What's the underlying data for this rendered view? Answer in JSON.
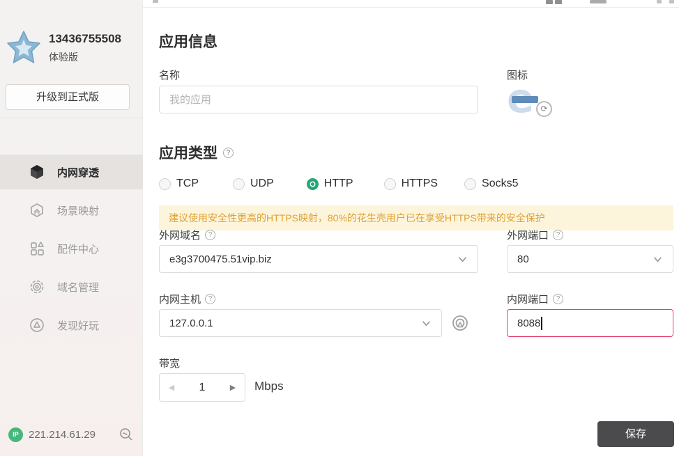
{
  "sidebar": {
    "account": {
      "phone": "13436755508",
      "plan": "体验版"
    },
    "upgrade_button": "升级到正式版",
    "menu": [
      {
        "label": "内网穿透",
        "icon": "cube-icon",
        "active": true
      },
      {
        "label": "场景映射",
        "icon": "scene-mapping-icon",
        "active": false
      },
      {
        "label": "配件中心",
        "icon": "addons-grid-icon",
        "active": false
      },
      {
        "label": "域名管理",
        "icon": "domain-gear-icon",
        "active": false
      },
      {
        "label": "发现好玩",
        "icon": "discover-compass-icon",
        "active": false
      }
    ],
    "footer": {
      "ip": "221.214.61.29"
    }
  },
  "main": {
    "section_app_info": "应用信息",
    "name_field": {
      "label": "名称",
      "placeholder": "我的应用",
      "value": ""
    },
    "icon_field": {
      "label": "图标"
    },
    "section_app_type": "应用类型",
    "app_types": {
      "options": [
        "TCP",
        "UDP",
        "HTTP",
        "HTTPS",
        "Socks5"
      ],
      "selected": "HTTP"
    },
    "notice": "建议使用安全性更高的HTTPS映射，80%的花生壳用户已在享受HTTPS带来的安全保护",
    "external_domain": {
      "label": "外网域名",
      "value": "e3g3700475.51vip.biz"
    },
    "external_port": {
      "label": "外网端口",
      "value": "80"
    },
    "internal_host": {
      "label": "内网主机",
      "value": "127.0.0.1"
    },
    "internal_port": {
      "label": "内网端口",
      "value": "8088"
    },
    "bandwidth": {
      "label": "带宽",
      "value": "1",
      "unit": "Mbps"
    },
    "save_button": "保存",
    "help_glyph": "?"
  },
  "colors": {
    "accent_green": "#21a675",
    "warning_bg": "#fdf5db",
    "warning_text": "#dfa135",
    "error_border": "#e63c64",
    "save_button_bg": "#4b4b4d",
    "ip_badge_green": "#45b97c",
    "sidebar_active_bg": "#e5e2e0",
    "star_blue": "#8cb8d4"
  }
}
